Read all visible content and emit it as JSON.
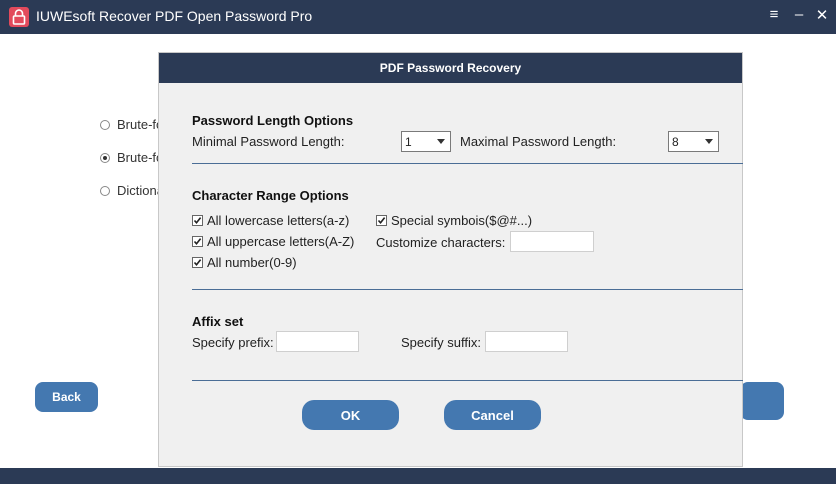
{
  "app": {
    "title": "IUWEsoft Recover PDF Open Password Pro",
    "menu_glyph": "≡",
    "minimize_glyph": "–",
    "close_glyph": "✕"
  },
  "background": {
    "radio_options": [
      {
        "label": "Brute-fo",
        "checked": false
      },
      {
        "label": "Brute-fo",
        "checked": true
      },
      {
        "label": "Dictiona",
        "checked": false
      }
    ],
    "back_label": "Back"
  },
  "dialog": {
    "title": "PDF Password Recovery",
    "length_section": {
      "title": "Password Length Options",
      "min_label": "Minimal Password Length:",
      "min_value": "1",
      "max_label": "Maximal Password Length:",
      "max_value": "8"
    },
    "charset_section": {
      "title": "Character Range Options",
      "lowercase_label": "All lowercase letters(a-z)",
      "uppercase_label": "All uppercase letters(A-Z)",
      "number_label": "All number(0-9)",
      "special_label": "Special symbois($@#...)",
      "customize_label": "Customize characters:",
      "customize_value": ""
    },
    "affix_section": {
      "title": "Affix set",
      "prefix_label": "Specify prefix:",
      "prefix_value": "",
      "suffix_label": "Specify suffix:",
      "suffix_value": ""
    },
    "ok_label": "OK",
    "cancel_label": "Cancel"
  },
  "colors": {
    "title_bar": "#2b3a55",
    "button_blue": "#4478b0",
    "separator": "#4a6d96",
    "logo_red": "#e24a5c"
  },
  "icons": {
    "app_logo": "lock-icon",
    "checkbox": "checkmark-icon"
  }
}
